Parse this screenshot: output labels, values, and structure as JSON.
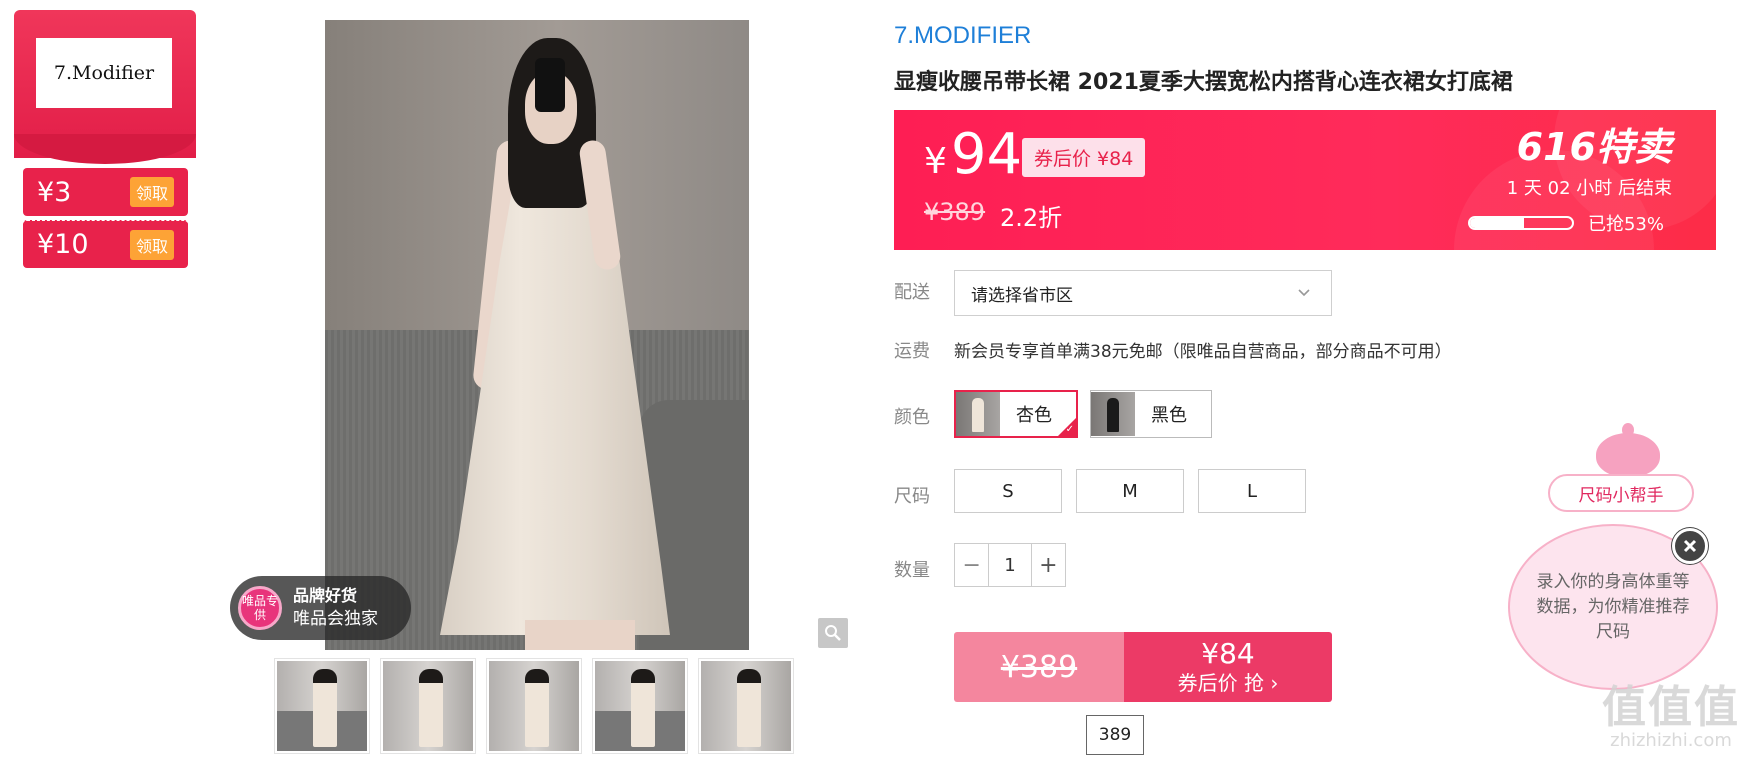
{
  "coupons": [
    {
      "amount": "¥3",
      "button": "领取"
    },
    {
      "amount": "¥10",
      "button": "领取"
    }
  ],
  "brand_logo_text": "7.Modifier",
  "badge": {
    "circle": "唯品专供",
    "title": "品牌好货",
    "subtitle": "唯品会独家"
  },
  "product": {
    "brand": "7.MODIFIER",
    "title": "显瘦收腰吊带长裙 2021夏季大摆宽松内搭背心连衣裙女打底裙"
  },
  "price": {
    "yen": "¥",
    "current": "94",
    "coupon_tag": "券后价 ¥84",
    "original": "¥389",
    "discount": "2.2折",
    "sale_title": "616特卖",
    "countdown": "1 天 02 小时 后结束",
    "progress_text": "已抢53%",
    "progress_fraction": 0.53
  },
  "delivery": {
    "label": "配送",
    "placeholder": "请选择省市区"
  },
  "shipping": {
    "label": "运费",
    "text": "新会员专享首单满38元免邮（限唯品自营商品，部分商品不可用）"
  },
  "colors": {
    "label": "颜色",
    "options": [
      {
        "name": "杏色",
        "selected": true
      },
      {
        "name": "黑色",
        "selected": false
      }
    ]
  },
  "sizes": {
    "label": "尺码",
    "options": [
      "S",
      "M",
      "L"
    ]
  },
  "quantity": {
    "label": "数量",
    "value": "1",
    "minus": "−",
    "plus": "+"
  },
  "buy": {
    "original": "¥389",
    "price": "¥84",
    "label": "券后价 抢 ›"
  },
  "tooltip": "389",
  "size_helper": {
    "button": "尺码小帮手",
    "message": "录入你的身高体重等数据，为你精准推荐尺码"
  },
  "watermark": {
    "main": "值值值",
    "domain": "zhizhizhi.com"
  },
  "accent_colors": {
    "brand_blue": "#1e7fd8",
    "sale_red": "#fe1e54",
    "coupon_orange": "#fda336",
    "buy_pink": "#ec3a66"
  }
}
